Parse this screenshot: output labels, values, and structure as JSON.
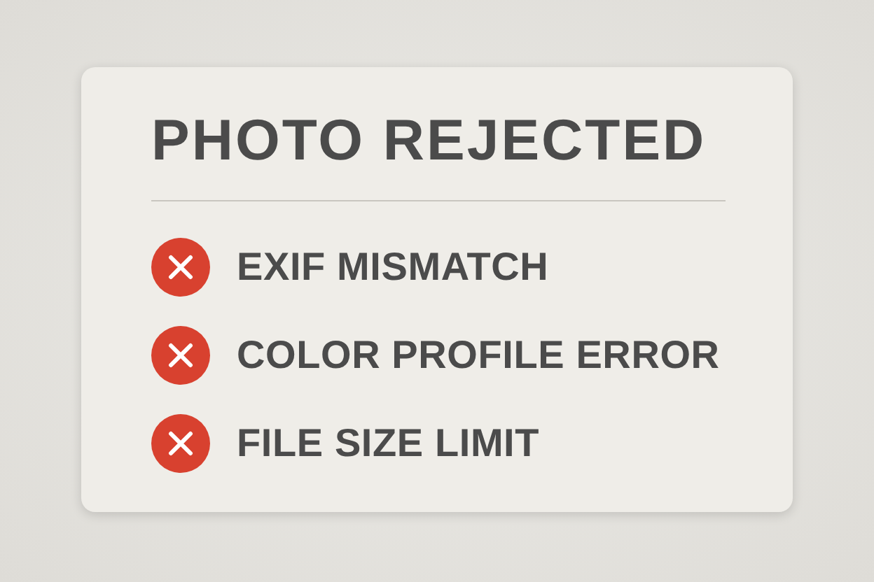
{
  "title": "PHOTO REJECTED",
  "errors": [
    {
      "text": "EXIF MISMATCH"
    },
    {
      "text": "COLOR PROFILE ERROR"
    },
    {
      "text": "FILE SIZE LIMIT"
    }
  ]
}
